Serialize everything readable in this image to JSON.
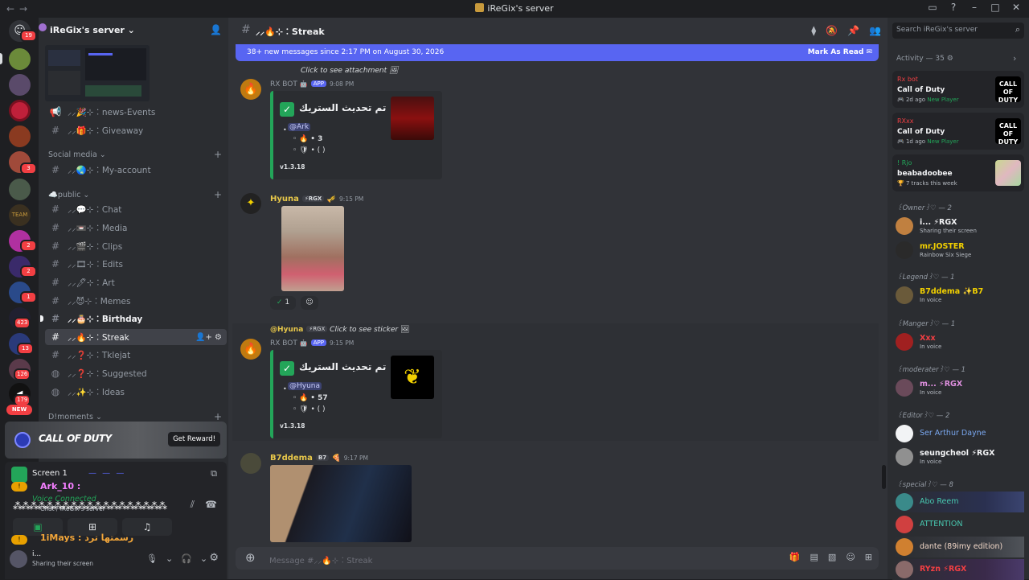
{
  "window": {
    "title": "iReGix's server"
  },
  "guilds": {
    "dm_badge": "19",
    "badges": [
      "3",
      "2",
      "2",
      "1",
      "423",
      "13",
      "126",
      "179"
    ],
    "new_label": "NEW"
  },
  "server": {
    "name": "iReGix's server ⌄"
  },
  "channels": [
    {
      "icon": "📢",
      "label": "⸝⸝🎉⊹︰news-Events"
    },
    {
      "icon": "#",
      "label": "⸝⸝🎁⊹︰Giveaway"
    },
    {
      "icon": "#",
      "label": "⸝⸝🌏⊹︰My-account"
    },
    {
      "icon": "#",
      "label": "⸝⸝💬⊹︰Chat"
    },
    {
      "icon": "#",
      "label": "⸝⸝📼⊹︰Media"
    },
    {
      "icon": "#",
      "label": "⸝⸝🎬⊹︰Clips"
    },
    {
      "icon": "#",
      "label": "⸝⸝🎞⊹︰Edits"
    },
    {
      "icon": "#",
      "label": "⸝⸝🖊⊹︰Art"
    },
    {
      "icon": "#",
      "label": "⸝⸝😈⊹︰Memes"
    },
    {
      "icon": "#",
      "label": "⸝⸝🎂⊹︰Birthday"
    },
    {
      "icon": "#",
      "label": "⸝⸝🔥⊹︰Streak"
    },
    {
      "icon": "#",
      "label": "⸝⸝❓⊹︰Tklejat"
    },
    {
      "icon": "#",
      "label": "⸝⸝❓⊹︰Suggested"
    },
    {
      "icon": "#",
      "label": "⸝⸝✨⊹︰Ideas"
    }
  ],
  "categories": {
    "social": "Social media ⌄",
    "public": "☁️public ⌄",
    "moments": "D!moments ⌄"
  },
  "promo": {
    "title": "CALL OF DUTY",
    "button": "Get Reward!"
  },
  "voice": {
    "screen_label": "Screen 1",
    "user1": "Ark_10 :",
    "connected": "Voice Connected",
    "server_line": "Chat / iReGix's server",
    "user2": "1iMays : رسمتها ترد",
    "self_status": "Sharing their screen"
  },
  "chat": {
    "channel_name": "⸝⸝🔥⊹︰Streak",
    "new_messages": "38+ new messages since 2:17 PM on August 30, 2026",
    "mark_read": "Mark As Read",
    "composer_placeholder": "Message #⸝⸝🔥⊹︰Streak"
  },
  "messages": {
    "m1": {
      "reply": "Click to see attachment",
      "author": "RX BOT",
      "tag": "APP",
      "time": "9:08 PM",
      "title": "تم تحديث الستريك •",
      "mention": "@Ark",
      "streak": "• 3",
      "shield": "• ( )",
      "version": "v1.3.18"
    },
    "m2": {
      "author": "Hyuna",
      "rgx": "⚡RGX",
      "time": "9:15 PM",
      "reaction_count": "1"
    },
    "m3": {
      "reply_author": "@Hyuna",
      "reply_rgx": "⚡RGX",
      "reply": "Click to see sticker",
      "author": "RX BOT",
      "tag": "APP",
      "time": "9:15 PM",
      "title": "تم تحديث الستريك •",
      "mention": "@Hyuna",
      "streak": "• 57",
      "shield": "• ( )",
      "version": "v1.3.18"
    },
    "m4": {
      "author": "B7ddema",
      "rgx": "B7",
      "time": "9:17 PM"
    }
  },
  "members": {
    "search_placeholder": "Search iReGix's server",
    "activity_header": "Activity — 35",
    "activities": [
      {
        "who": "Rx bot",
        "game": "Call of Duty",
        "time": "2d ago",
        "badge": "New Player",
        "img": "CALL OF DUTY"
      },
      {
        "who": "RXxx",
        "game": "Call of Duty",
        "time": "1d ago",
        "badge": "New Player",
        "img": "CALL OF DUTY"
      },
      {
        "who": "! Rjo",
        "game": "beabadoobee",
        "time": "7 tracks this week",
        "badge": "",
        "img": ""
      }
    ],
    "roles": [
      {
        "label": "꒰Owner꒱♡ — 2"
      },
      {
        "label": "꒰Legend꒱♡ — 1"
      },
      {
        "label": "꒰Manger꒱♡ — 1"
      },
      {
        "label": "꒰moderater꒱♡ — 1"
      },
      {
        "label": "꒰Editor꒱♡ — 2"
      },
      {
        "label": "꒰special꒱♡ — 8"
      }
    ],
    "list": [
      {
        "name": "i... ⚡RGX",
        "status": "Sharing their screen"
      },
      {
        "name": "mr.JOSTER",
        "status": "Rainbow Six Siege"
      },
      {
        "name": "B7ddema ✨B7",
        "status": "In voice"
      },
      {
        "name": "Xxx",
        "status": "In voice"
      },
      {
        "name": "m... ⚡RGX",
        "status": "In voice"
      },
      {
        "name": "Ser Arthur Dayne",
        "status": ""
      },
      {
        "name": "seungcheol ⚡RGX",
        "status": "In voice"
      },
      {
        "name": "Abo Reem",
        "status": ""
      },
      {
        "name": "ATTENTION",
        "status": ""
      },
      {
        "name": "dante (89imy edition)",
        "status": ""
      },
      {
        "name": "RYzn ⚡RGX",
        "status": ""
      }
    ]
  }
}
